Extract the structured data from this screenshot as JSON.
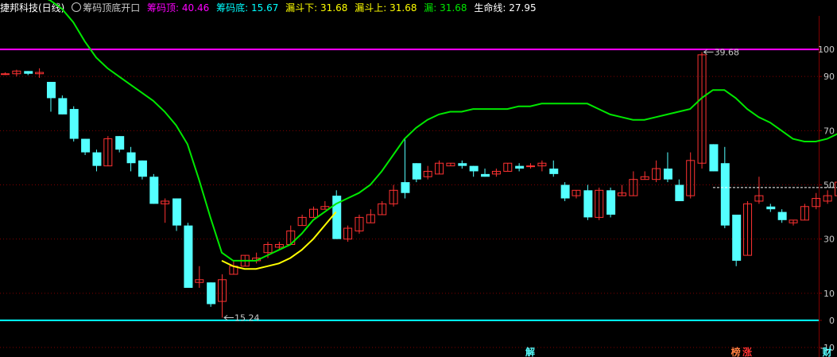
{
  "legend": {
    "stock": "捷邦科技(日线)",
    "indicator": "筹码顶底开口",
    "top_label": "筹码顶:",
    "top_value": "40.46",
    "bottom_label": "筹码底:",
    "bottom_value": "15.67",
    "funnel_low_label": "漏斗下:",
    "funnel_low_value": "31.68",
    "funnel_high_label": "漏斗上:",
    "funnel_high_value": "31.68",
    "leak_label": "漏:",
    "leak_value": "31.68",
    "life_label": "生命线:",
    "life_value": "27.95"
  },
  "colors": {
    "bg": "#000000",
    "up": "#ff3232",
    "down": "#54ffff",
    "top_line": "#ff00ff",
    "bottom_line": "#00ffff",
    "life_line": "#00e800",
    "funnel": "#ffff00",
    "grid": "#800000",
    "text": "#c8c8c8"
  },
  "chart_data": {
    "type": "candlestick",
    "y_axis_ticks": [
      "100",
      "90",
      "70",
      "50",
      "30",
      "10",
      "0",
      "-10"
    ],
    "ylim": [
      -10,
      110
    ],
    "horizontal_lines": [
      {
        "name": "筹码顶",
        "value": 100
      },
      {
        "name": "筹码底",
        "value": 0
      }
    ],
    "candles": [
      [
        91,
        91,
        91.5,
        90.5
      ],
      [
        91,
        92,
        92.5,
        90
      ],
      [
        92,
        91,
        92,
        90.5
      ],
      [
        91,
        91.5,
        93,
        89.5
      ],
      [
        88,
        82,
        88,
        77
      ],
      [
        82,
        76,
        83,
        76
      ],
      [
        78,
        67,
        79,
        66
      ],
      [
        67,
        62,
        67,
        61
      ],
      [
        62,
        57,
        63,
        55
      ],
      [
        57,
        67,
        68,
        57
      ],
      [
        68,
        63,
        68,
        62
      ],
      [
        62,
        58,
        64,
        55
      ],
      [
        59,
        53,
        59,
        52
      ],
      [
        53,
        43,
        54,
        43
      ],
      [
        43,
        44,
        45,
        36
      ],
      [
        45,
        35,
        45,
        33
      ],
      [
        35,
        12,
        36,
        12
      ],
      [
        14,
        15,
        20,
        12
      ],
      [
        14,
        6,
        14,
        5
      ],
      [
        7,
        15,
        17,
        1
      ],
      [
        17,
        20,
        22,
        17
      ],
      [
        20,
        24,
        24,
        20
      ],
      [
        22,
        23,
        25,
        21
      ],
      [
        25,
        28,
        29,
        23
      ],
      [
        27,
        28,
        29,
        26
      ],
      [
        28,
        33,
        35,
        28
      ],
      [
        35,
        38,
        39,
        35
      ],
      [
        38,
        41,
        42,
        38
      ],
      [
        41,
        42,
        44,
        41
      ],
      [
        46,
        30,
        48,
        30
      ],
      [
        30,
        34,
        35,
        29
      ],
      [
        33,
        38,
        39,
        32
      ],
      [
        36,
        39,
        41,
        36
      ],
      [
        39,
        43,
        44,
        39
      ],
      [
        43,
        48,
        50,
        42
      ],
      [
        51,
        47,
        67,
        45
      ],
      [
        58,
        52,
        58,
        51
      ],
      [
        53,
        55,
        57,
        52
      ],
      [
        54,
        58,
        59,
        54
      ],
      [
        57,
        58,
        58,
        57
      ],
      [
        58,
        57,
        59,
        56
      ],
      [
        57,
        55,
        57,
        53
      ],
      [
        54,
        53,
        56,
        53
      ],
      [
        54,
        55,
        56,
        53
      ],
      [
        55,
        58,
        58,
        55
      ],
      [
        57,
        56,
        58,
        55
      ],
      [
        57,
        57,
        58,
        56
      ],
      [
        57,
        58,
        59,
        55
      ],
      [
        56,
        54,
        59,
        53
      ],
      [
        50,
        45,
        51,
        44
      ],
      [
        46,
        48,
        48,
        45
      ],
      [
        48,
        38,
        50,
        37
      ],
      [
        38,
        48,
        49,
        37
      ],
      [
        48,
        39,
        49,
        38
      ],
      [
        46,
        47,
        50,
        46
      ],
      [
        46,
        52,
        55,
        46
      ],
      [
        52,
        53,
        55,
        52
      ],
      [
        52,
        56,
        59,
        51
      ],
      [
        56,
        52,
        62,
        51
      ],
      [
        50,
        44,
        52,
        44
      ],
      [
        46,
        59,
        62,
        45
      ],
      [
        58,
        98,
        99,
        56
      ],
      [
        65,
        55,
        65,
        55
      ],
      [
        58,
        35,
        64,
        34
      ],
      [
        39,
        22,
        39,
        20
      ],
      [
        24,
        43,
        44,
        24
      ],
      [
        44,
        46,
        53,
        43
      ],
      [
        42,
        41,
        43,
        40
      ],
      [
        40,
        37,
        41,
        36
      ],
      [
        36,
        37,
        37,
        35
      ],
      [
        37,
        42,
        43,
        37
      ],
      [
        42,
        45,
        47,
        41
      ],
      [
        44,
        46,
        48,
        43
      ],
      [
        46,
        51,
        53,
        45
      ],
      [
        53,
        55,
        55,
        53
      ]
    ],
    "series": [
      {
        "name": "生命线",
        "values": [
          120,
          120,
          120,
          120,
          118,
          115,
          110,
          103,
          97,
          93,
          90,
          87,
          84,
          81,
          77,
          72,
          65,
          52,
          38,
          25,
          22,
          22,
          22,
          24,
          26,
          28,
          32,
          37,
          40,
          43,
          45,
          47,
          50,
          55,
          61,
          67,
          71,
          74,
          76,
          77,
          77,
          78,
          78,
          78,
          78,
          79,
          79,
          80,
          80,
          80,
          80,
          80,
          78,
          76,
          75,
          74,
          74,
          75,
          76,
          77,
          78,
          82,
          85,
          85,
          82,
          78,
          75,
          73,
          70,
          67,
          66,
          66,
          67,
          69,
          72
        ]
      },
      {
        "name": "漏斗",
        "values": [
          null,
          null,
          null,
          null,
          null,
          null,
          null,
          null,
          null,
          null,
          null,
          null,
          null,
          null,
          null,
          null,
          null,
          null,
          null,
          22,
          20,
          19,
          19,
          20,
          21,
          23,
          26,
          30,
          35,
          40,
          null,
          null,
          null,
          null,
          null,
          null,
          null,
          null,
          null,
          null,
          null,
          null,
          null,
          null,
          null,
          null,
          null,
          null,
          null,
          null,
          null,
          null,
          null,
          null,
          null,
          null,
          null,
          null,
          null,
          null,
          null,
          null,
          null,
          null,
          null,
          null,
          null,
          null,
          null,
          null,
          null,
          null,
          null,
          null,
          null
        ]
      }
    ],
    "annotations": [
      {
        "text": "39.68",
        "index": 61,
        "value": 99,
        "pos": "right"
      },
      {
        "text": "15.24",
        "index": 19,
        "value": 1,
        "pos": "right"
      }
    ],
    "reference_line": {
      "from_index": 62,
      "to_index": 74,
      "value": 49
    },
    "event_markers": [
      {
        "text": "解",
        "index": 46,
        "color": "#54ffff"
      },
      {
        "text": "榜",
        "index": 64,
        "color": "#ff8040"
      },
      {
        "text": "涨",
        "index": 65,
        "color": "#ff3232"
      },
      {
        "text": "财",
        "index": 72,
        "color": "#54ffff"
      }
    ]
  }
}
